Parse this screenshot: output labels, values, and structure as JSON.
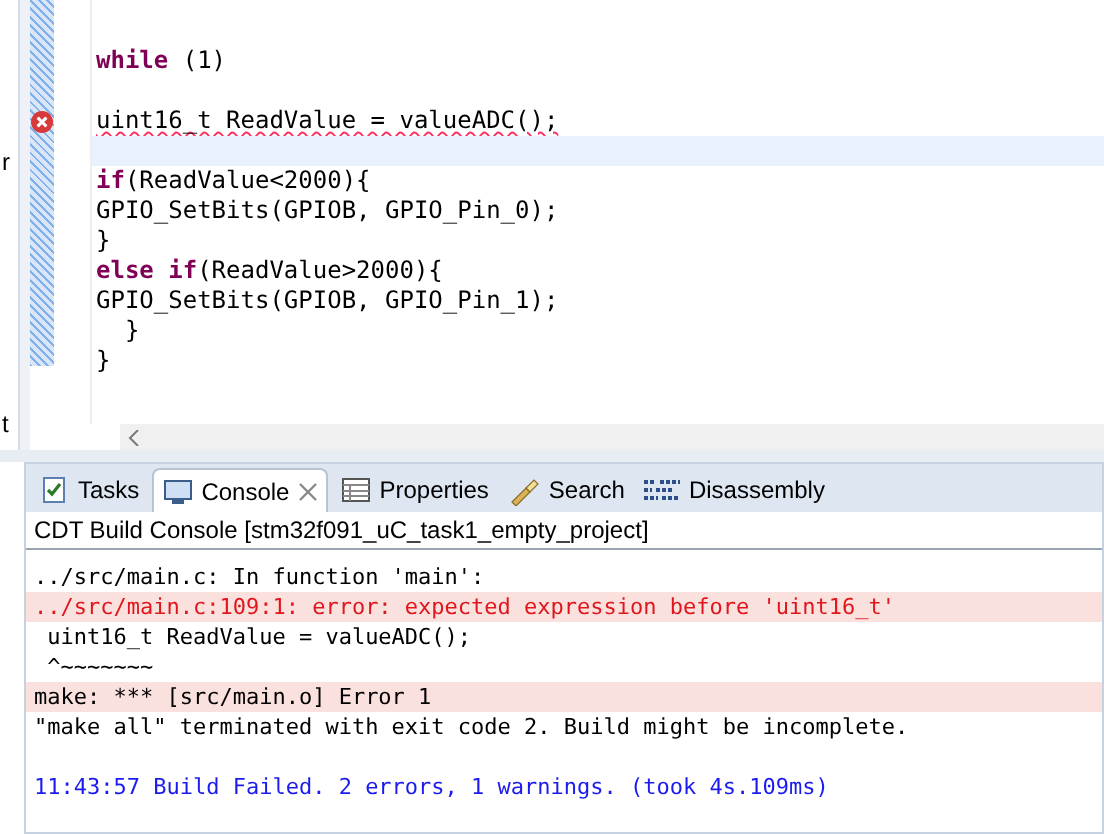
{
  "side_fragments": [
    "r",
    "t"
  ],
  "editor": {
    "lines": [
      {
        "kind": "blank"
      },
      {
        "kind": "code",
        "segments": [
          {
            "kind": "keyword",
            "text": "while"
          },
          {
            "kind": "plain",
            "text": " (1)"
          }
        ]
      },
      {
        "kind": "blank"
      },
      {
        "kind": "error",
        "segments": [
          {
            "kind": "plain",
            "text": "uint16_t ReadValue = valueADC();"
          }
        ]
      },
      {
        "kind": "current"
      },
      {
        "kind": "code",
        "segments": [
          {
            "kind": "keyword",
            "text": "if"
          },
          {
            "kind": "plain",
            "text": "(ReadValue<2000){"
          }
        ]
      },
      {
        "kind": "code",
        "segments": [
          {
            "kind": "plain",
            "text": "GPIO_SetBits(GPIOB, GPIO_Pin_0);"
          }
        ]
      },
      {
        "kind": "code",
        "segments": [
          {
            "kind": "plain",
            "text": "}"
          }
        ]
      },
      {
        "kind": "code",
        "segments": [
          {
            "kind": "keyword",
            "text": "else if"
          },
          {
            "kind": "plain",
            "text": "(ReadValue>2000){"
          }
        ]
      },
      {
        "kind": "code",
        "segments": [
          {
            "kind": "plain",
            "text": "GPIO_SetBits(GPIOB, GPIO_Pin_1);"
          }
        ]
      },
      {
        "kind": "code",
        "segments": [
          {
            "kind": "plain",
            "text": "  }"
          }
        ]
      },
      {
        "kind": "code",
        "segments": [
          {
            "kind": "plain",
            "text": "}"
          }
        ]
      }
    ]
  },
  "tabs": [
    {
      "label": "Tasks",
      "selected": false,
      "closable": false
    },
    {
      "label": "Console",
      "selected": true,
      "closable": true
    },
    {
      "label": "Properties",
      "selected": false,
      "closable": false
    },
    {
      "label": "Search",
      "selected": false,
      "closable": false
    },
    {
      "label": "Disassembly",
      "selected": false,
      "closable": false
    }
  ],
  "console": {
    "title": "CDT Build Console [stm32f091_uC_task1_empty_project]",
    "lines": [
      {
        "kind": "normal",
        "text": "../src/main.c: In function 'main':"
      },
      {
        "kind": "error",
        "text": "../src/main.c:109:1: error: expected expression before 'uint16_t'"
      },
      {
        "kind": "normal",
        "text": " uint16_t ReadValue = valueADC();"
      },
      {
        "kind": "normal",
        "text": " ^~~~~~~~"
      },
      {
        "kind": "error_line",
        "text": "make: *** [src/main.o] Error 1"
      },
      {
        "kind": "normal",
        "text": "\"make all\" terminated with exit code 2. Build might be incomplete."
      },
      {
        "kind": "blank"
      },
      {
        "kind": "info",
        "text": "11:43:57 Build Failed. 2 errors, 1 warnings. (took 4s.109ms)"
      }
    ]
  }
}
